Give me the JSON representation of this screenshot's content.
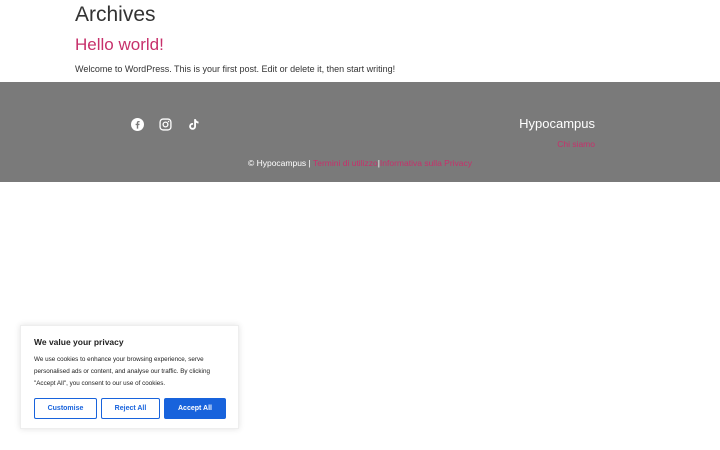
{
  "archive": {
    "title": "Archives",
    "post_title": "Hello world!",
    "post_excerpt": "Welcome to WordPress. This is your first post. Edit or delete it, then start writing!"
  },
  "footer": {
    "social_icons": [
      "facebook-icon",
      "instagram-icon",
      "tiktok-icon"
    ],
    "brand": "Hypocampus",
    "chi_siamo": "Chi siamo",
    "copyright": "© Hypocampus |",
    "separator": "|",
    "terms_link": "Termini di utilizzo",
    "privacy_link": "Informativa sulla Privacy"
  },
  "cookie": {
    "title": "We value your privacy",
    "text": "We use cookies to enhance your browsing experience, serve personalised ads or content, and analyse our traffic. By clicking \"Accept All\", you consent to our use of cookies.",
    "customise": "Customise",
    "reject": "Reject All",
    "accept": "Accept All"
  },
  "colors": {
    "accent": "#c7306b",
    "footer_bg": "#7a7a7a",
    "cookie_primary": "#1863dc"
  }
}
